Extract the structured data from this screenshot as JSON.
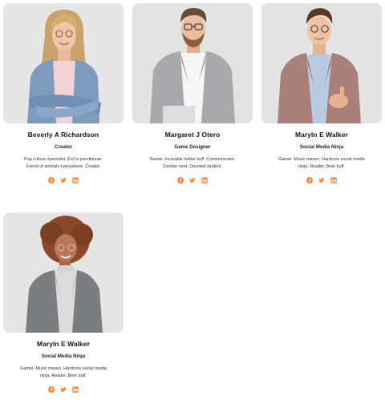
{
  "accent_color": "#f2883d",
  "members": [
    {
      "name": "Beverly A Richardson",
      "role": "Creator",
      "bio": "Pop culture specialist. Evil tv prectitioner. Friend of animals everywhere. Creator.",
      "socials": [
        "facebook-icon",
        "twitter-icon",
        "linkedin-icon"
      ]
    },
    {
      "name": "Margaret J Otero",
      "role": "Game Designer",
      "bio": "Gamer. Incurable twitter buff. Communicator. Zombie nerd. Devoted student.",
      "socials": [
        "facebook-icon",
        "twitter-icon",
        "linkedin-icon"
      ]
    },
    {
      "name": "Maryln E Walker",
      "role": "Social Media Ninja",
      "bio": "Gamer. Music maven. Hardcore social media ninja. Reader. Beer buff.",
      "socials": [
        "facebook-icon",
        "twitter-icon",
        "linkedin-icon"
      ]
    },
    {
      "name": "Maryln E Walker",
      "role": "Social Media Ninja",
      "bio": "Gamer. Music maven. Hardcore social media ninja. Reader. Beer buff.",
      "socials": [
        "facebook-icon",
        "twitter-icon",
        "linkedin-icon"
      ]
    }
  ]
}
